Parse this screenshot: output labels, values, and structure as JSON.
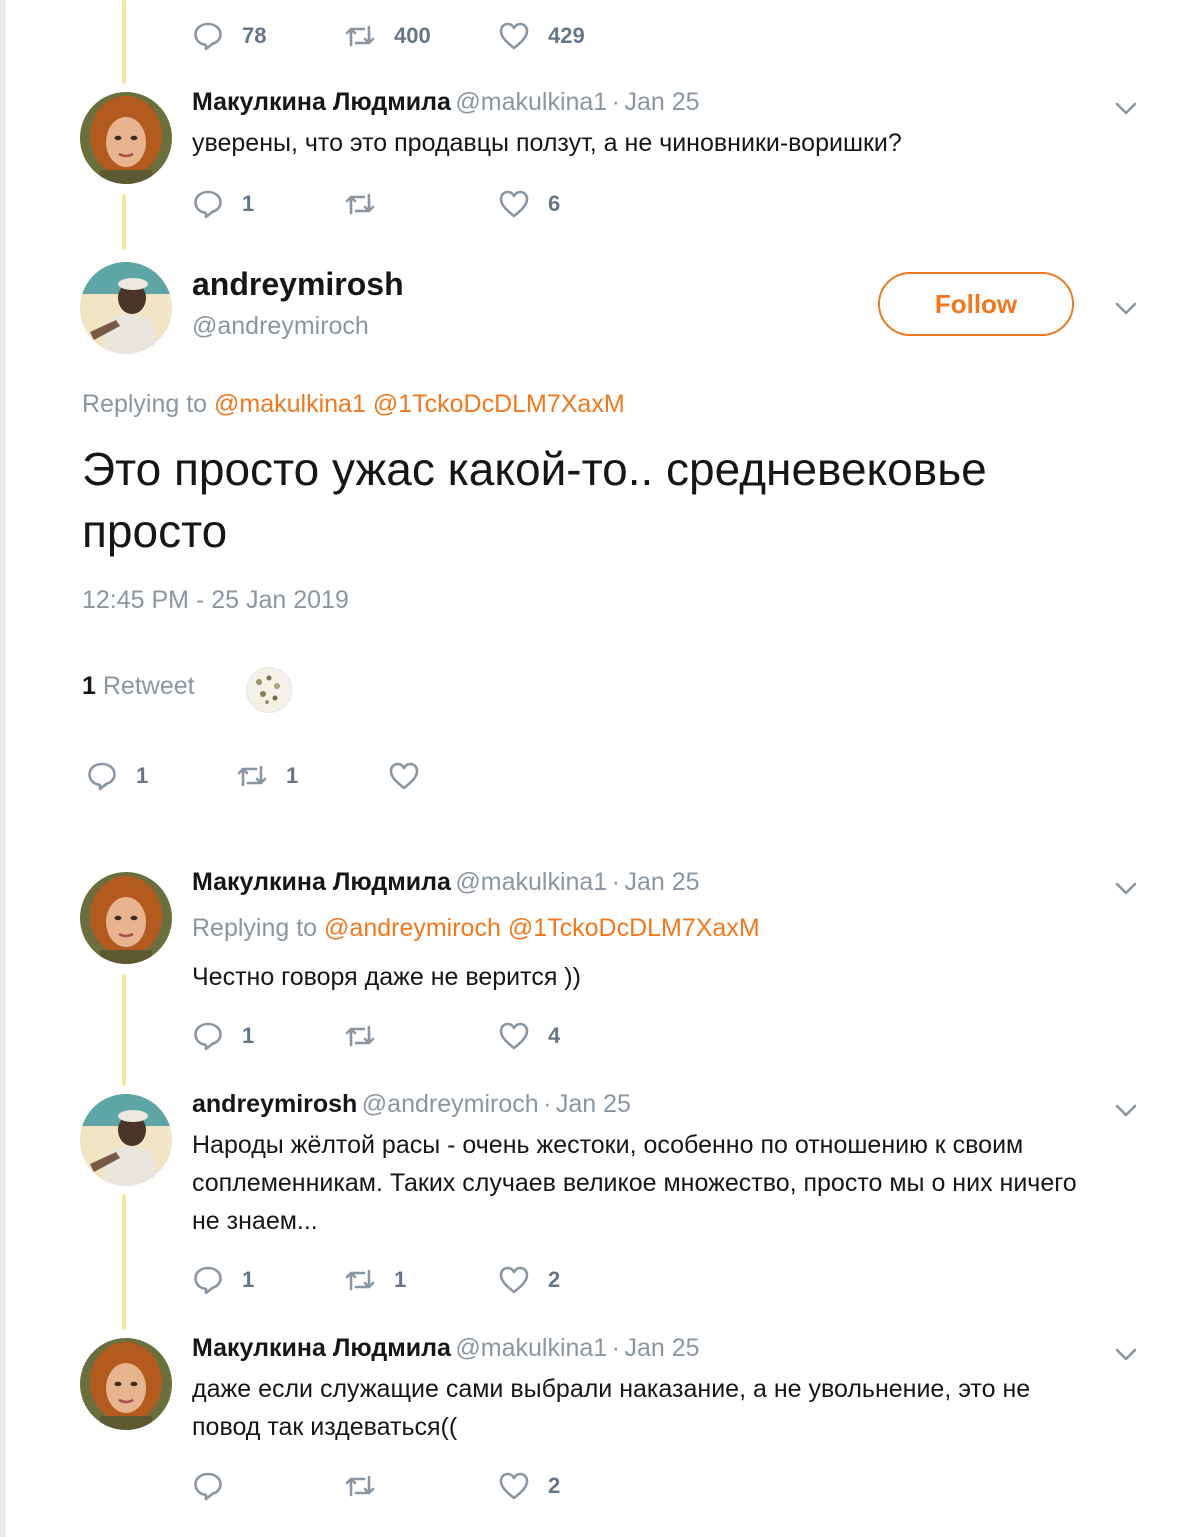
{
  "top_actions": {
    "replies": "78",
    "retweets": "400",
    "likes": "429"
  },
  "tweet1": {
    "name": "Макулкина Людмила",
    "handle": "@makulkina1",
    "sep": "·",
    "date": "Jan 25",
    "text": "уверены, что это продавцы ползут, а не чиновники-воришки?",
    "replies": "1",
    "retweets": "",
    "likes": "6"
  },
  "focused": {
    "name": "andreymirosh",
    "handle": "@andreymiroch",
    "follow_label": "Follow",
    "replying_label": "Replying to",
    "mention1": "@makulkina1",
    "mention2": "@1TckoDcDLM7XaxM",
    "text": "Это просто ужас какой-то.. средневековье просто",
    "timestamp": "12:45 PM - 25 Jan 2019",
    "retweet_count": "1",
    "retweet_label": "Retweet",
    "replies": "1",
    "retweets": "1",
    "likes": ""
  },
  "tweet2": {
    "name": "Макулкина Людмила",
    "handle": "@makulkina1",
    "sep": "·",
    "date": "Jan 25",
    "replying_label": "Replying to",
    "mention1": "@andreymiroch",
    "mention2": "@1TckoDcDLM7XaxM",
    "text": "Честно говоря даже не верится ))",
    "replies": "1",
    "retweets": "",
    "likes": "4"
  },
  "tweet3": {
    "name": "andreymirosh",
    "handle": "@andreymiroch",
    "sep": "·",
    "date": "Jan 25",
    "text_line1": "Народы жёлтой расы - очень жестоки, особенно по отношению к своим",
    "text_line2": "соплеменникам. Таких случаев великое множество, просто мы о них ничего",
    "text_line3": "не знаем...",
    "replies": "1",
    "retweets": "1",
    "likes": "2"
  },
  "tweet4": {
    "name": "Макулкина Людмила",
    "handle": "@makulkina1",
    "sep": "·",
    "date": "Jan 25",
    "text_line1": "даже если служащие сами выбрали наказание, а не увольнение, это не",
    "text_line2": "повод так издеваться((",
    "replies": "",
    "retweets": "",
    "likes": "2"
  },
  "colors": {
    "accent": "#f0781e",
    "muted": "#8a97a3",
    "thread": "#f5e6a0"
  },
  "icons": [
    "reply-icon",
    "retweet-icon",
    "like-icon",
    "chevron-down-icon",
    "avatar"
  ]
}
